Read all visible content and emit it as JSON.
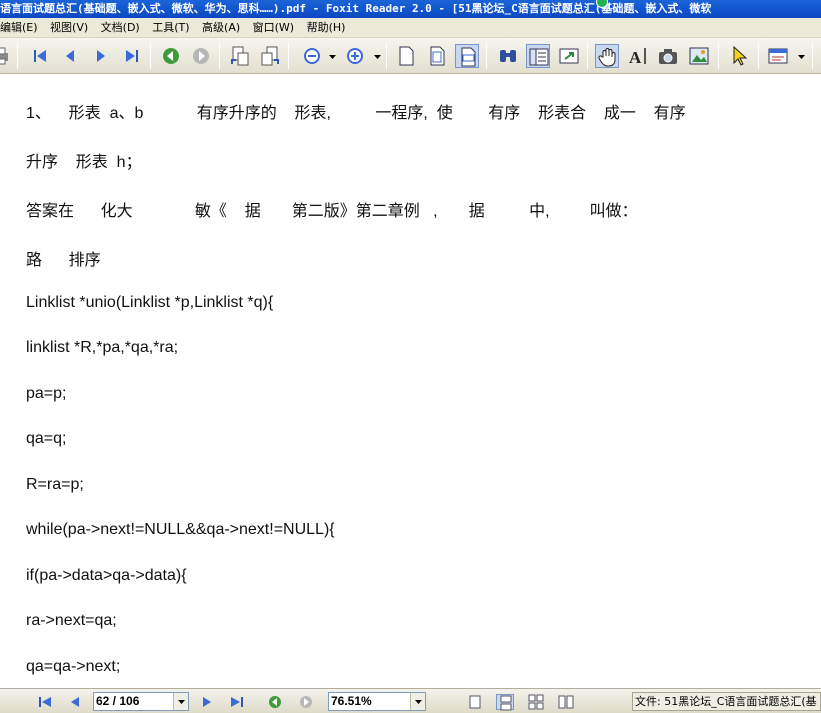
{
  "window": {
    "title": "语言面试题总汇(基础题、嵌入式、微软、华为、思科……).pdf - Foxit Reader 2.0 - [51黑论坛_C语言面试题总汇(基础题、嵌入式、微软"
  },
  "menu": {
    "items": [
      "编辑(E)",
      "视图(V)",
      "文档(D)",
      "工具(T)",
      "高级(A)",
      "窗口(W)",
      "帮助(H)"
    ]
  },
  "document": {
    "lines": [
      "1、    形表  a、b            有序升序的    形表,          一程序,  使        有序    形表合    成一    有序",
      "升序    形表  h；",
      "答案在      化大              敏《    据       第二版》第二章例   ,       据          中,         叫做：",
      "路      排序",
      "Linklist *unio(Linklist *p,Linklist *q){",
      "linklist *R,*pa,*qa,*ra;",
      "pa=p;",
      "qa=q;",
      "R=ra=p;",
      "while(pa->next!=NULL&&qa->next!=NULL){",
      "if(pa->data>qa->data){",
      "ra->next=qa;",
      "qa=qa->next;"
    ]
  },
  "statusbar": {
    "page_field": "62 / 106",
    "zoom_field": "76.51%",
    "status_text": "文件: 51黑论坛_C语言面试题总汇(基"
  },
  "icons": {
    "toolbar": [
      "print-icon",
      "first-page-icon",
      "prev-page-icon",
      "next-page-icon",
      "last-page-icon",
      "go-back-icon",
      "go-forward-icon",
      "rotate-left-icon",
      "rotate-right-icon",
      "zoom-out-icon",
      "zoom-in-icon",
      "actual-size-icon",
      "fit-page-icon",
      "fit-width-icon",
      "find-icon",
      "bookmarks-icon",
      "thumbnails-icon",
      "hand-tool-icon",
      "select-text-icon",
      "snapshot-icon",
      "image-tool-icon",
      "select-arrow-icon",
      "annotation-icon"
    ]
  },
  "colors": {
    "titlebar": "#0a48c2",
    "menubar": "#ece9d8",
    "accent_green": "#22b14c"
  }
}
